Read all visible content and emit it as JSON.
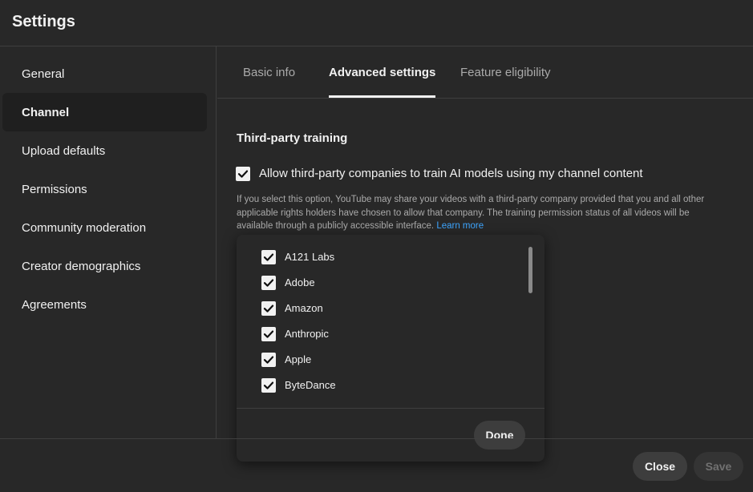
{
  "header": {
    "title": "Settings"
  },
  "sidebar": {
    "items": [
      {
        "label": "General"
      },
      {
        "label": "Channel"
      },
      {
        "label": "Upload defaults"
      },
      {
        "label": "Permissions"
      },
      {
        "label": "Community moderation"
      },
      {
        "label": "Creator demographics"
      },
      {
        "label": "Agreements"
      }
    ],
    "active": "Channel"
  },
  "tabs": {
    "items": [
      {
        "label": "Basic info"
      },
      {
        "label": "Advanced settings"
      },
      {
        "label": "Feature eligibility"
      }
    ],
    "active": "Advanced settings"
  },
  "third_party": {
    "section_title": "Third-party training",
    "allow_checked": true,
    "allow_label": "Allow third-party companies to train AI models using my channel content",
    "description": "If you select this option, YouTube may share your videos with a third-party company provided that you and all other applicable rights holders have chosen to allow that company. The training permission status of all videos will be available through a publicly accessible interface.",
    "learn_more": "Learn more"
  },
  "company_list": {
    "items": [
      {
        "label": "A121 Labs",
        "checked": true
      },
      {
        "label": "Adobe",
        "checked": true
      },
      {
        "label": "Amazon",
        "checked": true
      },
      {
        "label": "Anthropic",
        "checked": true
      },
      {
        "label": "Apple",
        "checked": true
      },
      {
        "label": "ByteDance",
        "checked": true
      }
    ],
    "done_label": "Done"
  },
  "footer": {
    "close_label": "Close",
    "save_label": "Save"
  },
  "colors": {
    "background": "#282828",
    "text": "#f1f1f1",
    "muted_text": "#aaaaaa",
    "link": "#3ea6ff",
    "button": "#3d3d3d",
    "active_sidebar": "#1f1f1f"
  }
}
